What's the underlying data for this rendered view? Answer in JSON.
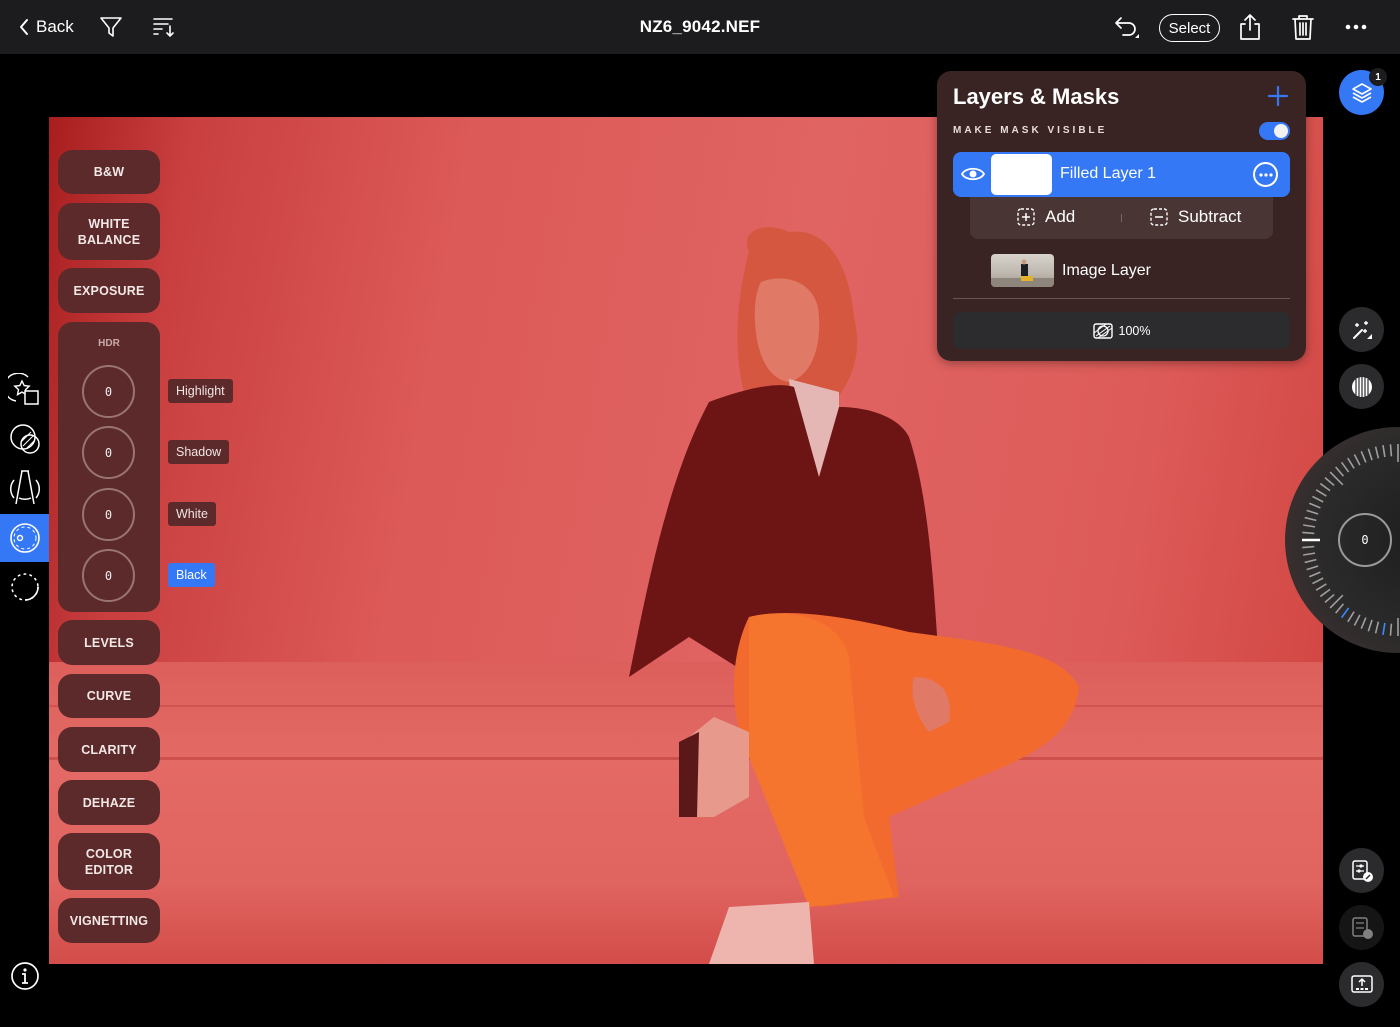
{
  "topbar": {
    "back_label": "Back",
    "title": "NZ6_9042.NEF",
    "select_label": "Select",
    "icons": [
      "chevron-left-icon",
      "filter-icon",
      "sort-icon",
      "undo-icon",
      "share-icon",
      "trash-icon",
      "more-icon"
    ]
  },
  "left_rail": {
    "items": [
      "presets-icon",
      "masks-icon",
      "perspective-icon",
      "adjust-dial-icon",
      "selection-icon"
    ],
    "active_index": 3,
    "info_icon": "info-icon"
  },
  "tools": {
    "bw": "B&W",
    "white_balance_1": "WHITE",
    "white_balance_2": "BALANCE",
    "exposure": "EXPOSURE",
    "levels": "LEVELS",
    "curve": "CURVE",
    "clarity": "CLARITY",
    "dehaze": "DEHAZE",
    "color_editor_1": "COLOR",
    "color_editor_2": "EDITOR",
    "vignetting": "VIGNETTING"
  },
  "hdr": {
    "title": "HDR",
    "controls": [
      {
        "label": "Highlight",
        "value": "0",
        "active": false
      },
      {
        "label": "Shadow",
        "value": "0",
        "active": false
      },
      {
        "label": "White",
        "value": "0",
        "active": false
      },
      {
        "label": "Black",
        "value": "0",
        "active": true
      }
    ]
  },
  "layers_panel": {
    "title": "Layers & Masks",
    "make_mask_visible_label": "MAKE MASK VISIBLE",
    "make_mask_visible": true,
    "layers": [
      {
        "name": "Filled Layer 1",
        "selected": true,
        "visible": true
      },
      {
        "name": "Image Layer",
        "selected": false
      }
    ],
    "add_label": "Add",
    "subtract_label": "Subtract",
    "opacity": "100%"
  },
  "right_rail": {
    "layers_badge": "1",
    "wheel_value": "0"
  },
  "colors": {
    "accent": "#3478f6",
    "topbar": "#1c1c1e",
    "tool_bg": "#5c2a2a",
    "panel_bg": "#3a2423",
    "mask_overlay": "#e06462"
  }
}
